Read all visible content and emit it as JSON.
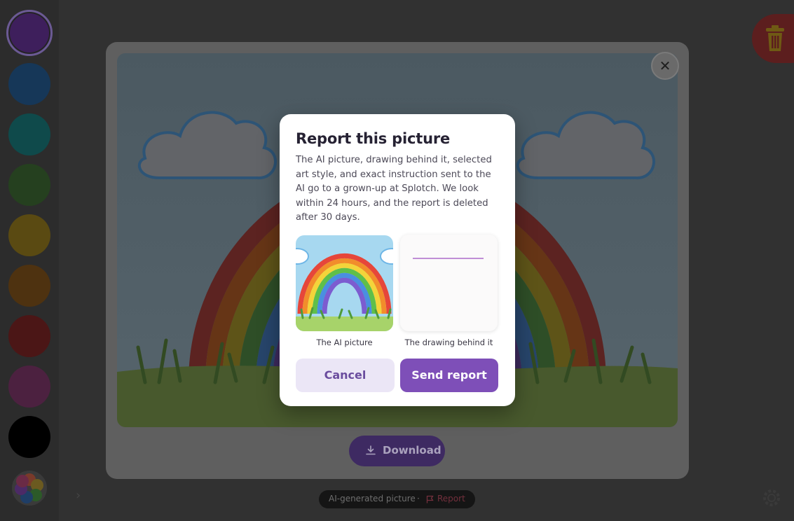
{
  "palette": {
    "colors": [
      "#3e1f5c",
      "#163758",
      "#0f4a4b",
      "#25401f",
      "#5a4a12",
      "#4e3210",
      "#4b1616",
      "#4c2140",
      "#000000"
    ],
    "selected_index": 0
  },
  "viewer": {
    "download_label": "Download",
    "close_symbol": "✕"
  },
  "footer": {
    "label": "AI-generated picture",
    "separator": "·",
    "report_label": "Report"
  },
  "report_dialog": {
    "title": "Report this picture",
    "description": "The AI picture, drawing behind it, selected art style, and exact instruction sent to the AI go to a grown-up at Splotch. We look within 24 hours, and the report is deleted after 30 days.",
    "ai_picture_caption": "The AI picture",
    "drawing_caption": "The drawing behind it",
    "cancel_label": "Cancel",
    "send_label": "Send report"
  },
  "icons": {
    "trash": "trash-icon",
    "close": "close-icon",
    "download": "download-icon",
    "flag": "flag-icon",
    "settings": "gear-icon",
    "expand": "chevron-right-icon"
  },
  "colors": {
    "accent": "#7e4fb8",
    "accent_soft": "#ebe6f6",
    "danger": "#c23a3a"
  }
}
